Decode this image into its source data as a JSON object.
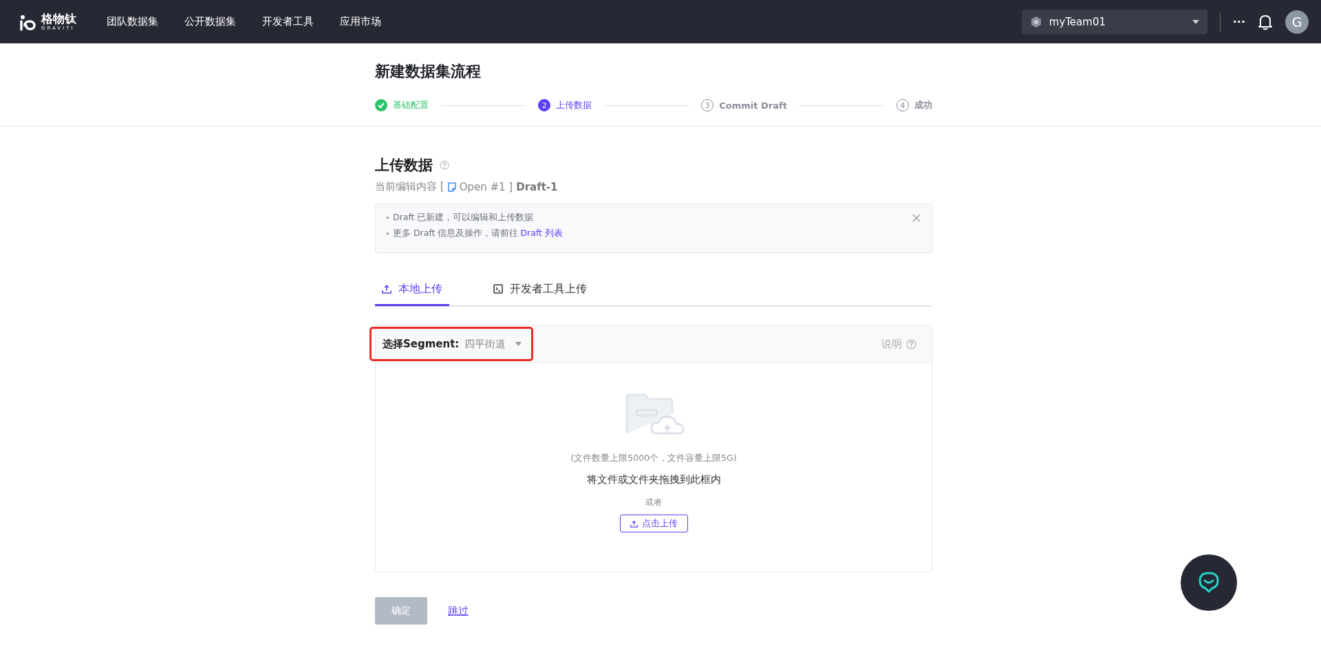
{
  "header": {
    "logo_text": "格物钛",
    "logo_subtext": "GRAVITI",
    "nav": [
      {
        "label": "团队数据集"
      },
      {
        "label": "公开数据集"
      },
      {
        "label": "开发者工具"
      },
      {
        "label": "应用市场"
      }
    ],
    "team": "myTeam01",
    "more": "···",
    "avatar": "G"
  },
  "page_title": "新建数据集流程",
  "steps": [
    {
      "label": "基础配置",
      "done": true,
      "selected": false
    },
    {
      "label": "上传数据",
      "number": "2",
      "done": false,
      "selected": true
    },
    {
      "label": "Commit Draft",
      "number": "3",
      "done": false,
      "selected": false
    },
    {
      "label": "成功",
      "number": "4",
      "done": false,
      "selected": false
    }
  ],
  "section": {
    "title": "上传数据",
    "editing_label": "当前编辑内容 [",
    "draft_ref": "Open #1 ]",
    "draft_name": "Draft-1"
  },
  "notice": {
    "lines": [
      {
        "text": "Draft 已新建，可以编辑和上传数据"
      },
      {
        "text": "更多 Draft 信息及操作，请前往",
        "link": "Draft 列表"
      }
    ]
  },
  "tabs": [
    {
      "label": "本地上传",
      "kind": "upload",
      "selected": true
    },
    {
      "label": "开发者工具上传",
      "kind": "terminal",
      "selected": false
    }
  ],
  "segment": {
    "label": "选择Segment:",
    "value": "四平街道",
    "highlighted": true,
    "help": "说明"
  },
  "dropzone": {
    "limit": "(文件数量上限5000个，文件容量上限5G)",
    "hint": "将文件或文件夹拖拽到此框内",
    "or": "或者",
    "button": "点击上传"
  },
  "actions": {
    "confirm": {
      "label": "确定",
      "disabled": true
    },
    "skip": "跳过"
  }
}
